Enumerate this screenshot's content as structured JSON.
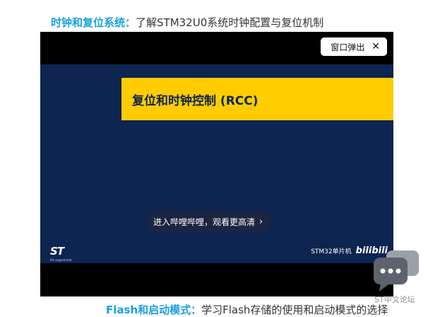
{
  "section_top": {
    "highlight": "时钟和复位系统：",
    "text": "了解STM32U0系统时钟配置与复位机制"
  },
  "player": {
    "popout_label": "窗口弹出",
    "close_glyph": "✕",
    "slide_title": "复位和时钟控制 (RCC)",
    "watch_prompt": "进入哔哩哔哩，观看更高清",
    "chevron": "›",
    "logo_mark": "ST",
    "logo_tag": "life.augmented",
    "channel_name": "STM32单片机",
    "channel_platform": "bilibili"
  },
  "section_bottom": {
    "highlight": "Flash和启动模式：",
    "text": "学习Flash存储的使用和启动模式的选择"
  },
  "forum_widget": {
    "label": "ST中文论坛",
    "icon": "chat-bubble-icon"
  },
  "colors": {
    "accent_blue": "#1aa0e0",
    "slide_navy": "#0e2451",
    "slide_yellow": "#ffcc00"
  }
}
